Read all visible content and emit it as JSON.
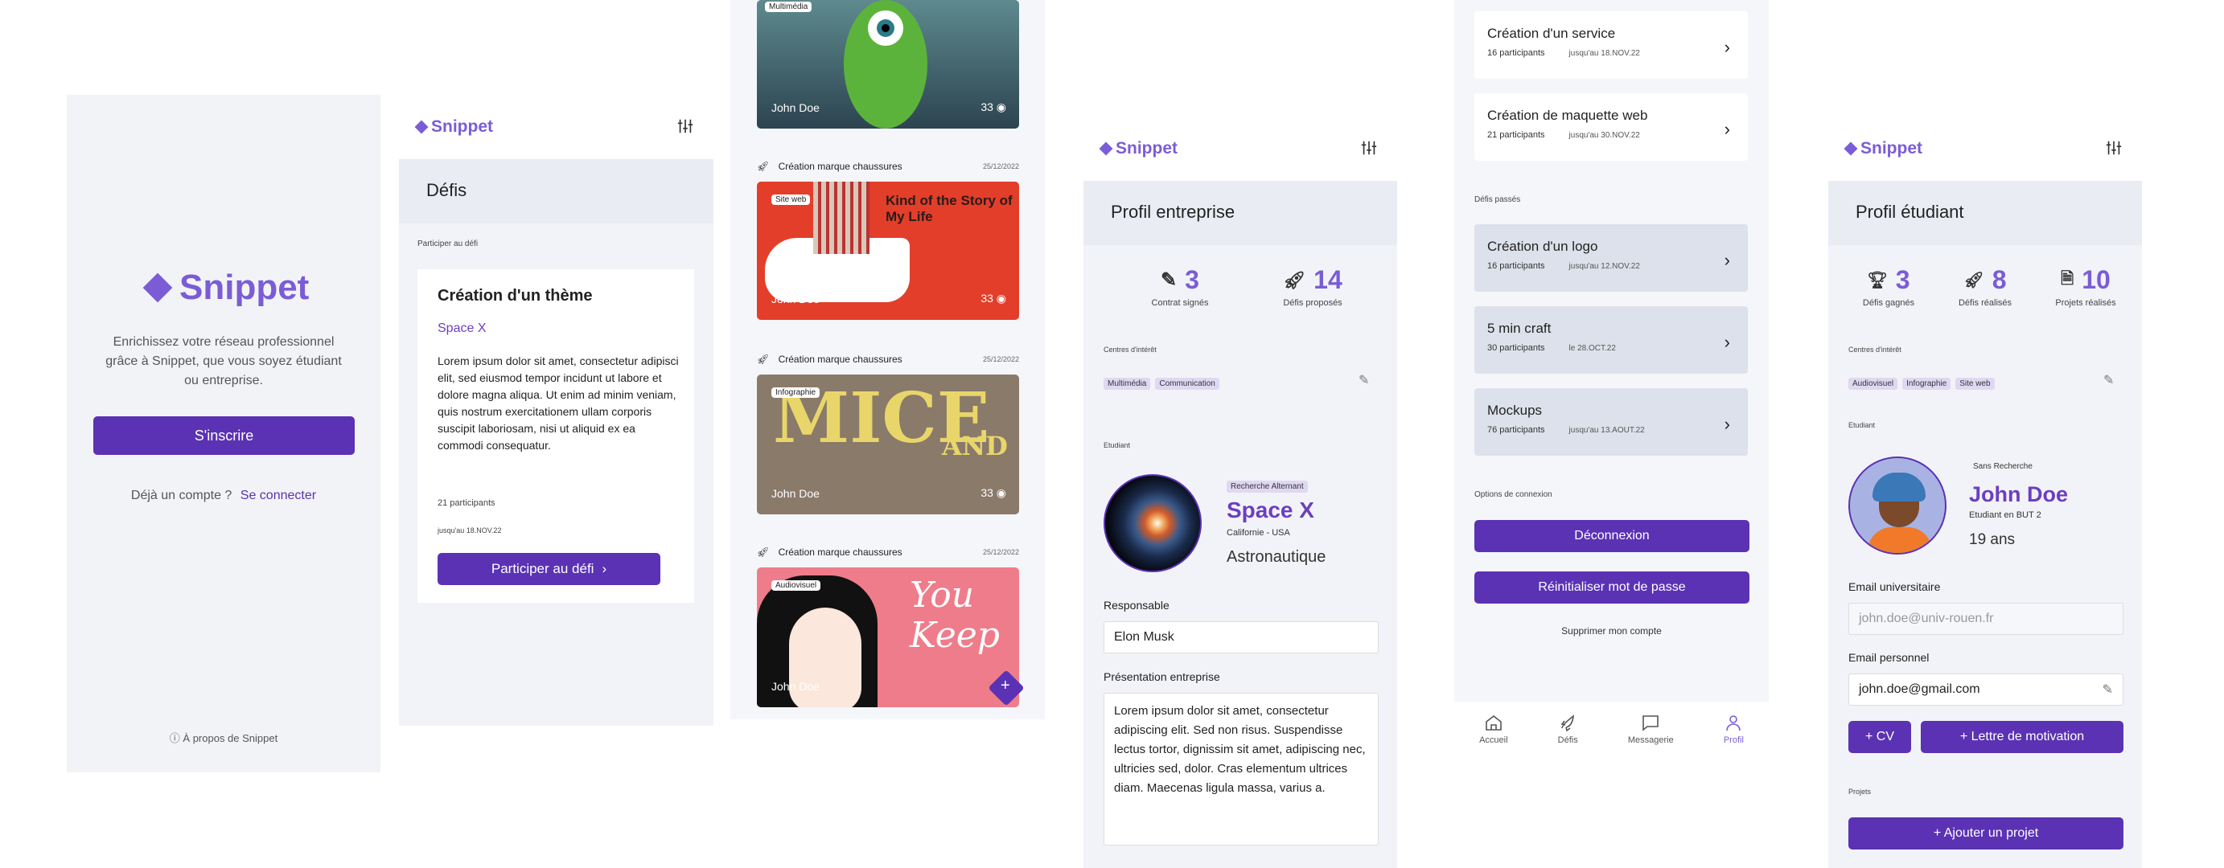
{
  "s1": {
    "logo": "Snippet",
    "tagline": "Enrichissez votre réseau professionnel grâce à Snippet, que vous soyez étudiant ou entreprise.",
    "signup": "S'inscrire",
    "have_account": "Déjà un compte ?",
    "login": "Se connecter",
    "about": "À propos de Snippet"
  },
  "nav": {
    "home": "Accueil",
    "defis": "Défis",
    "msg": "Messagerie",
    "profil": "Profil"
  },
  "s2": {
    "logo": "Snippet",
    "band": "Défis",
    "section": "Participer au défi",
    "card_title": "Création d'un thème",
    "company": "Space X",
    "body": "Lorem ipsum dolor sit amet, consectetur adipisci elit, sed eiusmod tempor incidunt ut labore et dolore magna aliqua. Ut enim ad minim veniam, quis nostrum exercitationem ullam corporis suscipit laboriosam, nisi ut aliquid ex ea commodi consequatur.",
    "participants": "21 participants",
    "deadline": "jusqu'au 18.NOV.22",
    "cta": "Participer au défi"
  },
  "s3": {
    "items": [
      {
        "title": "",
        "date": "",
        "tag": "Multimédia",
        "name": "John Doe",
        "count": "33"
      },
      {
        "title": "Création marque chaussures",
        "date": "25/12/2022",
        "tag": "Site web",
        "name": "John Doe",
        "count": "33"
      },
      {
        "title": "Création marque chaussures",
        "date": "25/12/2022",
        "tag": "Infographie",
        "name": "John Doe",
        "count": "33"
      },
      {
        "title": "Création marque chaussures",
        "date": "25/12/2022",
        "tag": "Audiovisuel",
        "name": "John Doe",
        "count": "33"
      }
    ]
  },
  "s4": {
    "logo": "Snippet",
    "band": "Profil entreprise",
    "stat1_v": "3",
    "stat1_l": "Contrat signés",
    "stat2_v": "14",
    "stat2_l": "Défis proposés",
    "interests_label": "Centres d'intérêt",
    "chips": [
      "Multimédia",
      "Communication"
    ],
    "student_label": "Etudiant",
    "badge": "Recherche Alternant",
    "company": "Space X",
    "location": "Californie - USA",
    "sector": "Astronautique",
    "resp_label": "Responsable",
    "resp_value": "Elon Musk",
    "pres_label": "Présentation entreprise",
    "pres_value": "Lorem ipsum dolor sit amet, consectetur adipiscing elit. Sed non risus. Suspendisse lectus tortor, dignissim sit amet, adipiscing nec, ultricies sed, dolor. Cras elementum ultrices diam. Maecenas ligula massa, varius a."
  },
  "s5": {
    "items_top": [
      {
        "name": "Création d'un service",
        "p": "16 participants",
        "d": "jusqu'au 18.NOV.22"
      },
      {
        "name": "Création de maquette web",
        "p": "21 participants",
        "d": "jusqu'au 30.NOV.22"
      }
    ],
    "past_label": "Défis passés",
    "items_past": [
      {
        "name": "Création d'un logo",
        "p": "16 participants",
        "d": "jusqu'au 12.NOV.22"
      },
      {
        "name": "5 min craft",
        "p": "30 participants",
        "d": "le 28.OCT.22"
      },
      {
        "name": "Mockups",
        "p": "76 participants",
        "d": "jusqu'au 13.AOUT.22"
      }
    ],
    "options_label": "Options de connexion",
    "logout": "Déconnexion",
    "reset": "Réinitialiser mot de passe",
    "delete": "Supprimer mon compte"
  },
  "s6": {
    "logo": "Snippet",
    "band": "Profil étudiant",
    "stat1_v": "3",
    "stat1_l": "Défis gagnés",
    "stat2_v": "8",
    "stat2_l": "Défis réalisés",
    "stat3_v": "10",
    "stat3_l": "Projets réalisés",
    "interests_label": "Centres d'intérêt",
    "chips": [
      "Audiovisuel",
      "Infographie",
      "Site web"
    ],
    "student_label": "Etudiant",
    "search": "Sans Recherche",
    "name": "John Doe",
    "school": "Etudiant en BUT 2",
    "age": "19 ans",
    "email_u_label": "Email universitaire",
    "email_u": "john.doe@univ-rouen.fr",
    "email_p_label": "Email personnel",
    "email_p": "john.doe@gmail.com",
    "cv": "+ CV",
    "lettre": "+ Lettre de motivation",
    "projets": "Projets",
    "add_proj": "+ Ajouter un projet"
  }
}
